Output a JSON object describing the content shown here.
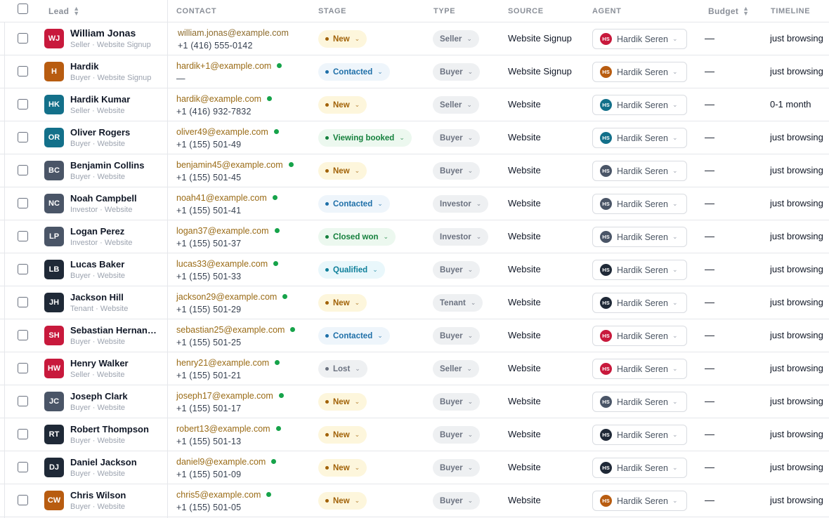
{
  "header": {
    "lead": "Lead",
    "contact": "CONTACT",
    "stage": "STAGE",
    "type": "TYPE",
    "source": "SOURCE",
    "agent": "AGENT",
    "budget": "Budget",
    "timeline": "TIMELINE"
  },
  "colors": {
    "stage": {
      "New": {
        "bg": "#fdf6dc",
        "fg": "#a16207",
        "dot": "#a16207"
      },
      "Contacted": {
        "bg": "#eef5fb",
        "fg": "#1e6fa8",
        "dot": "#1e6fa8"
      },
      "Viewing booked": {
        "bg": "#ecf8ef",
        "fg": "#15803d",
        "dot": "#15803d"
      },
      "Closed won": {
        "bg": "#ecf8ef",
        "fg": "#15803d",
        "dot": "#15803d"
      },
      "Qualified": {
        "bg": "#e9f7fb",
        "fg": "#0e7f9a",
        "dot": "#0e7f9a"
      },
      "Lost": {
        "bg": "#eef0f2",
        "fg": "#6b7280",
        "dot": "#6b7280"
      }
    }
  },
  "rows": [
    {
      "initials": "WJ",
      "avatar_color": "#c8193c",
      "name": "William Jonas",
      "sub": "Seller · Website Signup",
      "email": "william.jonas@example.com",
      "online": false,
      "phone": "+1 (416) 555-0142",
      "stage": "New",
      "type": "Seller",
      "source": "Website Signup",
      "agent_initials": "HS",
      "agent_color": "#c8193c",
      "agent": "Hardik Seren",
      "budget": "—",
      "timeline": "just browsing"
    },
    {
      "initials": "H",
      "avatar_color": "#b85c10",
      "name": "Hardik",
      "sub": "Buyer · Website Signup",
      "email": "hardik+1@example.com",
      "online": true,
      "phone": "—",
      "stage": "Contacted",
      "type": "Buyer",
      "source": "Website Signup",
      "agent_initials": "HS",
      "agent_color": "#b85c10",
      "agent": "Hardik Seren",
      "budget": "—",
      "timeline": "just browsing"
    },
    {
      "initials": "HK",
      "avatar_color": "#13708a",
      "name": "Hardik Kumar",
      "sub": "Seller · Website",
      "email": "hardik@example.com",
      "online": true,
      "phone": "+1 (416) 932-7832",
      "stage": "New",
      "type": "Seller",
      "source": "Website",
      "agent_initials": "HS",
      "agent_color": "#13708a",
      "agent": "Hardik Seren",
      "budget": "—",
      "timeline": "0-1 month"
    },
    {
      "initials": "OR",
      "avatar_color": "#13708a",
      "name": "Oliver Rogers",
      "sub": "Buyer · Website",
      "email": "oliver49@example.com",
      "online": true,
      "phone": "+1 (155) 501-49",
      "stage": "Viewing booked",
      "type": "Buyer",
      "source": "Website",
      "agent_initials": "HS",
      "agent_color": "#13708a",
      "agent": "Hardik Seren",
      "budget": "—",
      "timeline": "just browsing"
    },
    {
      "initials": "BC",
      "avatar_color": "#4a5567",
      "name": "Benjamin Collins",
      "sub": "Buyer · Website",
      "email": "benjamin45@example.com",
      "online": true,
      "phone": "+1 (155) 501-45",
      "stage": "New",
      "type": "Buyer",
      "source": "Website",
      "agent_initials": "HS",
      "agent_color": "#4a5567",
      "agent": "Hardik Seren",
      "budget": "—",
      "timeline": "just browsing"
    },
    {
      "initials": "NC",
      "avatar_color": "#4a5567",
      "name": "Noah Campbell",
      "sub": "Investor · Website",
      "email": "noah41@example.com",
      "online": true,
      "phone": "+1 (155) 501-41",
      "stage": "Contacted",
      "type": "Investor",
      "source": "Website",
      "agent_initials": "HS",
      "agent_color": "#4a5567",
      "agent": "Hardik Seren",
      "budget": "—",
      "timeline": "just browsing"
    },
    {
      "initials": "LP",
      "avatar_color": "#4a5567",
      "name": "Logan Perez",
      "sub": "Investor · Website",
      "email": "logan37@example.com",
      "online": true,
      "phone": "+1 (155) 501-37",
      "stage": "Closed won",
      "type": "Investor",
      "source": "Website",
      "agent_initials": "HS",
      "agent_color": "#4a5567",
      "agent": "Hardik Seren",
      "budget": "—",
      "timeline": "just browsing"
    },
    {
      "initials": "LB",
      "avatar_color": "#1f2937",
      "name": "Lucas Baker",
      "sub": "Buyer · Website",
      "email": "lucas33@example.com",
      "online": true,
      "phone": "+1 (155) 501-33",
      "stage": "Qualified",
      "type": "Buyer",
      "source": "Website",
      "agent_initials": "HS",
      "agent_color": "#1f2937",
      "agent": "Hardik Seren",
      "budget": "—",
      "timeline": "just browsing"
    },
    {
      "initials": "JH",
      "avatar_color": "#1f2937",
      "name": "Jackson Hill",
      "sub": "Tenant · Website",
      "email": "jackson29@example.com",
      "online": true,
      "phone": "+1 (155) 501-29",
      "stage": "New",
      "type": "Tenant",
      "source": "Website",
      "agent_initials": "HS",
      "agent_color": "#1f2937",
      "agent": "Hardik Seren",
      "budget": "—",
      "timeline": "just browsing"
    },
    {
      "initials": "SH",
      "avatar_color": "#c8193c",
      "name": "Sebastian Hernandez",
      "sub": "Buyer · Website",
      "email": "sebastian25@example.com",
      "online": true,
      "phone": "+1 (155) 501-25",
      "stage": "Contacted",
      "type": "Buyer",
      "source": "Website",
      "agent_initials": "HS",
      "agent_color": "#c8193c",
      "agent": "Hardik Seren",
      "budget": "—",
      "timeline": "just browsing"
    },
    {
      "initials": "HW",
      "avatar_color": "#c8193c",
      "name": "Henry Walker",
      "sub": "Seller · Website",
      "email": "henry21@example.com",
      "online": true,
      "phone": "+1 (155) 501-21",
      "stage": "Lost",
      "type": "Seller",
      "source": "Website",
      "agent_initials": "HS",
      "agent_color": "#c8193c",
      "agent": "Hardik Seren",
      "budget": "—",
      "timeline": "just browsing"
    },
    {
      "initials": "JC",
      "avatar_color": "#4a5567",
      "name": "Joseph Clark",
      "sub": "Buyer · Website",
      "email": "joseph17@example.com",
      "online": true,
      "phone": "+1 (155) 501-17",
      "stage": "New",
      "type": "Buyer",
      "source": "Website",
      "agent_initials": "HS",
      "agent_color": "#4a5567",
      "agent": "Hardik Seren",
      "budget": "—",
      "timeline": "just browsing"
    },
    {
      "initials": "RT",
      "avatar_color": "#1f2937",
      "name": "Robert Thompson",
      "sub": "Buyer · Website",
      "email": "robert13@example.com",
      "online": true,
      "phone": "+1 (155) 501-13",
      "stage": "New",
      "type": "Buyer",
      "source": "Website",
      "agent_initials": "HS",
      "agent_color": "#1f2937",
      "agent": "Hardik Seren",
      "budget": "—",
      "timeline": "just browsing"
    },
    {
      "initials": "DJ",
      "avatar_color": "#1f2937",
      "name": "Daniel Jackson",
      "sub": "Buyer · Website",
      "email": "daniel9@example.com",
      "online": true,
      "phone": "+1 (155) 501-09",
      "stage": "New",
      "type": "Buyer",
      "source": "Website",
      "agent_initials": "HS",
      "agent_color": "#1f2937",
      "agent": "Hardik Seren",
      "budget": "—",
      "timeline": "just browsing"
    },
    {
      "initials": "CW",
      "avatar_color": "#b85c10",
      "name": "Chris Wilson",
      "sub": "Buyer · Website",
      "email": "chris5@example.com",
      "online": true,
      "phone": "+1 (155) 501-05",
      "stage": "New",
      "type": "Buyer",
      "source": "Website",
      "agent_initials": "HS",
      "agent_color": "#b85c10",
      "agent": "Hardik Seren",
      "budget": "—",
      "timeline": "just browsing"
    }
  ]
}
